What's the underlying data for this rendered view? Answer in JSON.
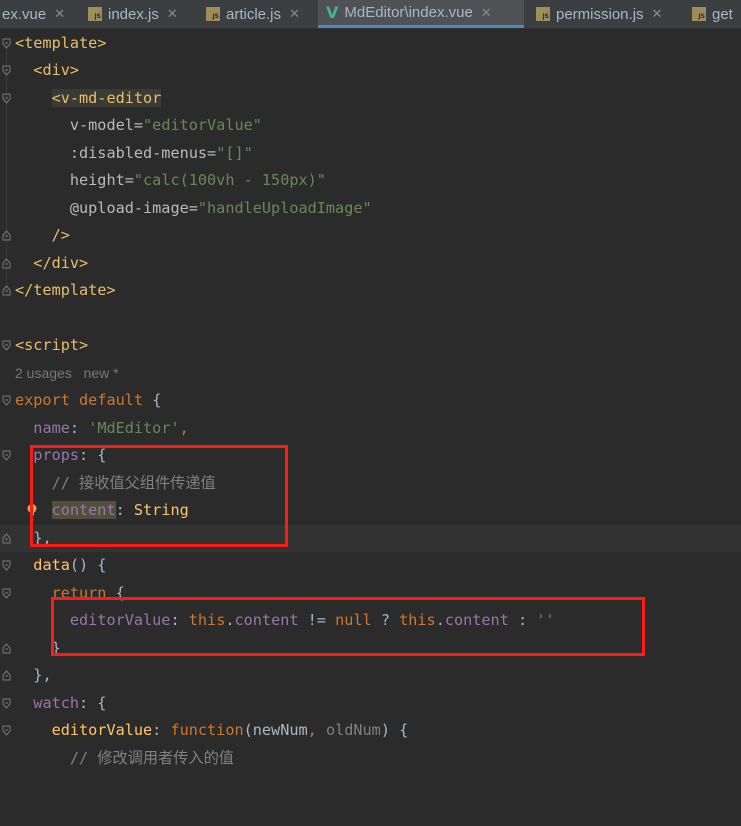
{
  "tabs": [
    {
      "label": "ex.vue",
      "icon": "vue-icon",
      "active": false
    },
    {
      "label": "index.js",
      "icon": "js-file-icon",
      "active": false
    },
    {
      "label": "article.js",
      "icon": "js-file-icon",
      "active": false
    },
    {
      "label": "MdEditor\\index.vue",
      "icon": "vue-icon",
      "active": true
    },
    {
      "label": "permission.js",
      "icon": "js-file-icon",
      "active": false
    },
    {
      "label": "get",
      "icon": "js-file-icon",
      "active": false
    }
  ],
  "code": {
    "l1": {
      "a": "<template>"
    },
    "l2": {
      "a": "<div>"
    },
    "l3": {
      "a": "<",
      "b": "v-md-editor"
    },
    "l4": {
      "a": "v-model=",
      "b": "\"editorValue\""
    },
    "l5": {
      "a": ":disabled-menus=",
      "b": "\"[]\""
    },
    "l6": {
      "a": "height=",
      "b": "\"calc(100vh - 150px)\""
    },
    "l7": {
      "a": "@upload-image=",
      "b": "\"handleUploadImage\""
    },
    "l8": {
      "a": "/>"
    },
    "l9": {
      "a": "</div>"
    },
    "l10": {
      "a": "</template>"
    },
    "l12": {
      "a": "<script>"
    },
    "hint": {
      "usages": "2 usages",
      "new": "new *"
    },
    "l13": {
      "a": "export",
      "b": "default",
      "c": "{"
    },
    "l14": {
      "a": "name",
      "b": ": ",
      "c": "'MdEditor'",
      "d": ","
    },
    "l15": {
      "a": "props",
      "b": ": {"
    },
    "l16": {
      "a": "// 接收值父组件传递值"
    },
    "l17": {
      "a": "content",
      "b": ": ",
      "c": "String"
    },
    "l18": {
      "a": "},"
    },
    "l19": {
      "a": "data",
      "b": "() {"
    },
    "l20": {
      "a": "return",
      "b": " {"
    },
    "l21": {
      "a": "editorValue",
      "b": ": ",
      "c": "this",
      "d": ".",
      "e": "content",
      "f": " != ",
      "g": "null",
      "h": " ? ",
      "i": "this",
      "j": ".",
      "k": "content",
      "l": " : ",
      "m": "''"
    },
    "l22": {
      "a": "}"
    },
    "l23": {
      "a": "},"
    },
    "l24": {
      "a": "watch",
      "b": ": {"
    },
    "l25": {
      "a": "editorValue",
      "b": ": ",
      "c": "function",
      "d": "(newNum",
      "e": ", ",
      "f": "oldNum",
      "g": ") {"
    },
    "l26": {
      "a": "// 修改调用者传入的值"
    }
  },
  "colors": {
    "background": "#2b2b2b",
    "tag": "#e8bf6a",
    "string": "#6a8759",
    "keyword": "#cc7832",
    "property": "#9876aa",
    "comment": "#808080",
    "annotation_box": "#ff1a1a"
  }
}
